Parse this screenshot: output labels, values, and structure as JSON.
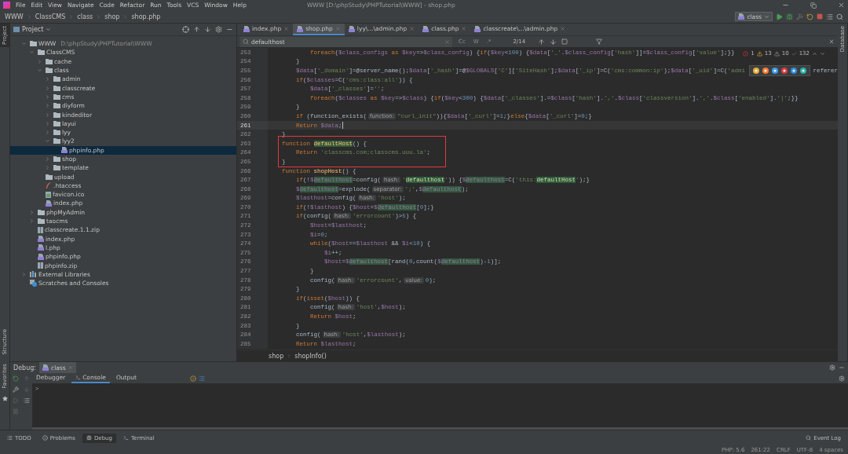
{
  "menu_bar": {
    "items": [
      "File",
      "Edit",
      "View",
      "Navigate",
      "Code",
      "Refactor",
      "Run",
      "Tools",
      "VCS",
      "Window",
      "Help"
    ],
    "title": "WWW [D:\\phpStudy\\PHPTutorial\\WWW] - shop.php"
  },
  "nav_bar": {
    "breadcrumbs": [
      "WWW",
      "ClassCMS",
      "class",
      "shop",
      "shop.php"
    ],
    "run_config": "class"
  },
  "left_strip": {
    "top": "Project",
    "bottom": [
      "Structure",
      "Favorites"
    ]
  },
  "right_strip": "Database",
  "project": {
    "title": "Project",
    "tree": [
      {
        "label": "WWW",
        "kind": "folder",
        "hint": "D:\\phpStudy\\PHPTutorial\\WWW",
        "expanded": true,
        "selected": false,
        "children": [
          {
            "label": "ClassCMS",
            "kind": "folder",
            "expanded": true,
            "selected": false,
            "children": [
              {
                "label": "cache",
                "kind": "folder",
                "expanded": false,
                "selected": false
              },
              {
                "label": "class",
                "kind": "folder",
                "expanded": true,
                "selected": false,
                "children": [
                  {
                    "label": "admin",
                    "kind": "folder",
                    "expanded": false,
                    "selected": false
                  },
                  {
                    "label": "classcreate",
                    "kind": "folder",
                    "expanded": false,
                    "selected": false
                  },
                  {
                    "label": "cms",
                    "kind": "folder",
                    "expanded": false,
                    "selected": false
                  },
                  {
                    "label": "diyform",
                    "kind": "folder",
                    "expanded": false,
                    "selected": false
                  },
                  {
                    "label": "kindeditor",
                    "kind": "folder",
                    "expanded": false,
                    "selected": false
                  },
                  {
                    "label": "layui",
                    "kind": "folder",
                    "expanded": false,
                    "selected": false
                  },
                  {
                    "label": "lyy",
                    "kind": "folder",
                    "expanded": false,
                    "selected": false
                  },
                  {
                    "label": "lyy2",
                    "kind": "folder",
                    "expanded": true,
                    "selected": false,
                    "children": [
                      {
                        "label": "phpinfo.php",
                        "kind": "php",
                        "selected": true
                      }
                    ]
                  },
                  {
                    "label": "shop",
                    "kind": "folder",
                    "expanded": false,
                    "selected": false
                  },
                  {
                    "label": "template",
                    "kind": "folder",
                    "expanded": false,
                    "selected": false
                  }
                ]
              },
              {
                "label": "upload",
                "kind": "folder",
                "selected": false
              },
              {
                "label": ".htaccess",
                "kind": "htaccess",
                "selected": false
              },
              {
                "label": "favicon.ico",
                "kind": "ico",
                "selected": false
              },
              {
                "label": "index.php",
                "kind": "php",
                "selected": false
              }
            ]
          },
          {
            "label": "phpMyAdmin",
            "kind": "folder",
            "expanded": false,
            "selected": false
          },
          {
            "label": "taocms",
            "kind": "folder",
            "expanded": false,
            "selected": false
          },
          {
            "label": "classcreate.1.1.zip",
            "kind": "zip",
            "selected": false
          },
          {
            "label": "index.php",
            "kind": "php",
            "selected": false
          },
          {
            "label": "l.php",
            "kind": "php",
            "selected": false
          },
          {
            "label": "phpinfo.php",
            "kind": "php",
            "selected": false
          },
          {
            "label": "phpinfo.zip",
            "kind": "zip",
            "selected": false
          }
        ]
      },
      {
        "label": "External Libraries",
        "kind": "library",
        "expanded": false,
        "selected": false
      },
      {
        "label": "Scratches and Consoles",
        "kind": "scratches",
        "selected": false
      }
    ]
  },
  "editor": {
    "tabs": [
      {
        "label": "index.php",
        "selected": false
      },
      {
        "label": "shop.php",
        "selected": true
      },
      {
        "label": "lyy\\...\\admin.php",
        "selected": false
      },
      {
        "label": "class.php",
        "selected": false
      },
      {
        "label": "classcreate\\...\\admin.php",
        "selected": false
      }
    ],
    "search": {
      "value": "defaulthost",
      "match_case": "Cc",
      "words": "W",
      "regex": ".*",
      "count": "2/14"
    },
    "inspections": {
      "errors": "1",
      "warnings": "13",
      "weak": "10",
      "typos": "132"
    },
    "lines": [
      {
        "no": "253",
        "current": false,
        "boxed": false,
        "code": [
          "            foreach($class_configs as $key=>$class_config) {if($key<100) {$data['_'.$class_config['hash']]=$class_config['value'];}}"
        ]
      },
      {
        "no": "254",
        "current": false,
        "boxed": false,
        "code": [
          "        }"
        ]
      },
      {
        "no": "255",
        "current": false,
        "boxed": false,
        "code": [
          "        $data['_domain']=@server_name();$data['_hash']=@$GLOBALS['C']['SiteHash'];$data['_ip']=C('cms:common:ip');$data['_uid']=C('admi"
        ],
        "after_popup": "referer"
      },
      {
        "no": "256",
        "current": false,
        "boxed": false,
        "code": [
          "        if($classes=C('cms:class:all')) {"
        ]
      },
      {
        "no": "257",
        "current": false,
        "boxed": false,
        "code": [
          "            $data['_classes']='';"
        ]
      },
      {
        "no": "258",
        "current": false,
        "boxed": false,
        "code": [
          "            foreach($classes as $key=>$class) {if($key<300) {$data['_classes'].=$class['hash'].','.$class['classversion'].','.$class['enabled'].'|';}}"
        ]
      },
      {
        "no": "259",
        "current": false,
        "boxed": false,
        "code": [
          "        }"
        ]
      },
      {
        "no": "260",
        "current": false,
        "boxed": false,
        "code": [
          "        if (function_exists(",
          {
            "hint": "function:"
          },
          "\"curl_init\")){$data['_curl']=1;}else{$data['_curl']=0;}"
        ]
      },
      {
        "no": "261",
        "current": true,
        "boxed": false,
        "code": [
          "        Return $data;"
        ]
      },
      {
        "no": "262",
        "current": false,
        "boxed": false,
        "code": [
          "    }"
        ]
      },
      {
        "no": "263",
        "current": false,
        "boxed": true,
        "code": [
          "    function defaultHost() {"
        ]
      },
      {
        "no": "264",
        "current": false,
        "boxed": true,
        "code": [
          "        Return 'classcms.com;classcms.uuu.la';"
        ]
      },
      {
        "no": "265",
        "current": false,
        "boxed": true,
        "code": [
          "    }"
        ]
      },
      {
        "no": "266",
        "current": false,
        "boxed": false,
        "code": [
          "    function shopHost() {"
        ]
      },
      {
        "no": "267",
        "current": false,
        "boxed": false,
        "code": [
          "        if(!$defaulthost=config(",
          {
            "hint": "hash:"
          },
          "'defaulthost')) {$defaulthost=C('this:defaultHost');}"
        ]
      },
      {
        "no": "268",
        "current": false,
        "boxed": false,
        "code": [
          "        $defaulthost=explode(",
          {
            "hint": "separator:"
          },
          "';',$defaulthost);"
        ]
      },
      {
        "no": "269",
        "current": false,
        "boxed": false,
        "code": [
          "        $lasthost=config(",
          {
            "hint": "hash:"
          },
          "'host');"
        ]
      },
      {
        "no": "270",
        "current": false,
        "boxed": false,
        "code": [
          "        if(!$lasthost) {$host=$defaulthost[0];}"
        ]
      },
      {
        "no": "271",
        "current": false,
        "boxed": false,
        "code": [
          "        if(config(",
          {
            "hint": "hash:"
          },
          "'errorcount')>5) {"
        ]
      },
      {
        "no": "272",
        "current": false,
        "boxed": false,
        "code": [
          "            $host=$lasthost;"
        ]
      },
      {
        "no": "273",
        "current": false,
        "boxed": false,
        "code": [
          "            $i=0;"
        ]
      },
      {
        "no": "274",
        "current": false,
        "boxed": false,
        "code": [
          "            while($host==$lasthost && $i<10) {"
        ]
      },
      {
        "no": "275",
        "current": false,
        "boxed": false,
        "code": [
          "                $i++;"
        ]
      },
      {
        "no": "276",
        "current": false,
        "boxed": false,
        "code": [
          "                $host=$defaulthost[rand(0,count($defaulthost)-1)];"
        ]
      },
      {
        "no": "277",
        "current": false,
        "boxed": false,
        "code": [
          "            }"
        ]
      },
      {
        "no": "278",
        "current": false,
        "boxed": false,
        "code": [
          "            config(",
          {
            "hint": "hash:"
          },
          "'errorcount',",
          {
            "hint": "value:"
          },
          "0);"
        ]
      },
      {
        "no": "279",
        "current": false,
        "boxed": false,
        "code": [
          "        }"
        ]
      },
      {
        "no": "280",
        "current": false,
        "boxed": false,
        "code": [
          "        if(isset($host)) {"
        ]
      },
      {
        "no": "281",
        "current": false,
        "boxed": false,
        "code": [
          "            config(",
          {
            "hint": "hash:"
          },
          "'host',$host);"
        ]
      },
      {
        "no": "282",
        "current": false,
        "boxed": false,
        "code": [
          "            Return $host;"
        ]
      },
      {
        "no": "283",
        "current": false,
        "boxed": false,
        "code": [
          "        }"
        ]
      },
      {
        "no": "284",
        "current": false,
        "boxed": false,
        "code": [
          "        config(",
          {
            "hint": "hash:"
          },
          "'host',$lasthost);"
        ]
      },
      {
        "no": "285",
        "current": false,
        "boxed": false,
        "code": [
          "        Return $lasthost;"
        ]
      }
    ],
    "breadcrumbs": [
      "shop",
      "shopInfo()"
    ]
  },
  "debug": {
    "label": "Debug:",
    "session": "class",
    "tabs": [
      {
        "label": "Debugger",
        "selected": false
      },
      {
        "label": "Console",
        "selected": true
      },
      {
        "label": "Output",
        "selected": false
      }
    ],
    "prompt": ">"
  },
  "tool_windows": [
    {
      "label": "TODO",
      "selected": false
    },
    {
      "label": "Problems",
      "selected": false
    },
    {
      "label": "Debug",
      "selected": true
    },
    {
      "label": "Terminal",
      "selected": false
    }
  ],
  "event_log": "Event Log",
  "status_bar": [
    "PHP: 5.6",
    "261:22",
    "CRLF",
    "UTF-8",
    "4 spaces"
  ]
}
